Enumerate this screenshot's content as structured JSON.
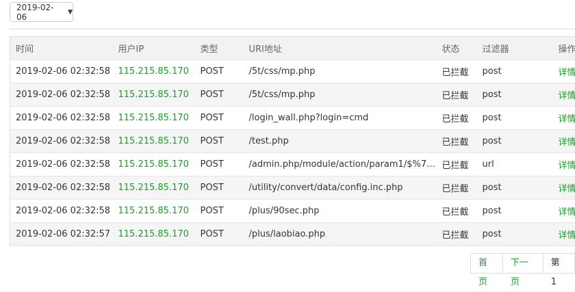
{
  "filter": {
    "date_value": "2019-02-06"
  },
  "table": {
    "headers": [
      "时间",
      "用户IP",
      "类型",
      "URI地址",
      "状态",
      "过滤器",
      "操作"
    ],
    "rows": [
      {
        "time": "2019-02-06 02:32:58",
        "ip": "115.215.85.170",
        "type": "POST",
        "uri": "/5t/css/mp.php",
        "status": "已拦截",
        "filter": "post",
        "action": "详情"
      },
      {
        "time": "2019-02-06 02:32:58",
        "ip": "115.215.85.170",
        "type": "POST",
        "uri": "/5t/css/mp.php",
        "status": "已拦截",
        "filter": "post",
        "action": "详情"
      },
      {
        "time": "2019-02-06 02:32:58",
        "ip": "115.215.85.170",
        "type": "POST",
        "uri": "/login_wall.php?login=cmd",
        "status": "已拦截",
        "filter": "post",
        "action": "详情"
      },
      {
        "time": "2019-02-06 02:32:58",
        "ip": "115.215.85.170",
        "type": "POST",
        "uri": "/test.php",
        "status": "已拦截",
        "filter": "post",
        "action": "详情"
      },
      {
        "time": "2019-02-06 02:32:58",
        "ip": "115.215.85.170",
        "type": "POST",
        "uri": "/admin.php/module/action/param1/$%7B...",
        "status": "已拦截",
        "filter": "url",
        "action": "详情"
      },
      {
        "time": "2019-02-06 02:32:58",
        "ip": "115.215.85.170",
        "type": "POST",
        "uri": "/utility/convert/data/config.inc.php",
        "status": "已拦截",
        "filter": "post",
        "action": "详情"
      },
      {
        "time": "2019-02-06 02:32:58",
        "ip": "115.215.85.170",
        "type": "POST",
        "uri": "/plus/90sec.php",
        "status": "已拦截",
        "filter": "post",
        "action": "详情"
      },
      {
        "time": "2019-02-06 02:32:57",
        "ip": "115.215.85.170",
        "type": "POST",
        "uri": "/plus/laobiao.php",
        "status": "已拦截",
        "filter": "post",
        "action": "详情"
      }
    ]
  },
  "pagination": {
    "first": "首页",
    "next": "下一页",
    "page_info": "第 1"
  }
}
